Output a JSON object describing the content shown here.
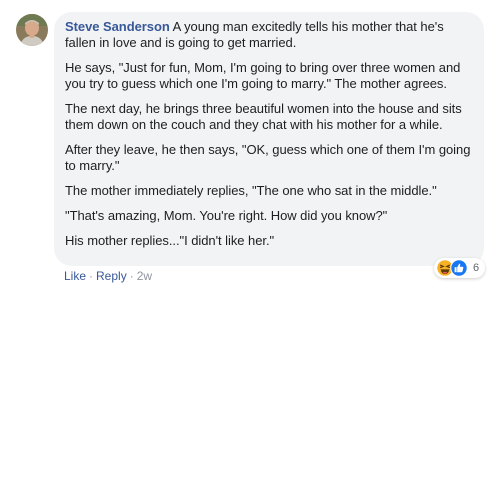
{
  "comment": {
    "author": "Steve Sanderson",
    "paragraphs": [
      "A young man excitedly tells his mother that he's fallen in love and is going to get married.",
      "He says, \"Just for fun, Mom, I'm going to bring over three women and you try to guess which one I'm going to marry.\" The mother agrees.",
      "The next day, he brings three beautiful women into the house and sits them down on the couch and they chat with his mother for a while.",
      "After they leave, he then says, \"OK, guess which one of them I'm going to marry.\"",
      "The mother immediately replies, \"The one who sat in the middle.\"",
      "\"That's amazing, Mom. You're right. How did you know?\"",
      "His mother replies...\"I didn't like her.\""
    ]
  },
  "actions": {
    "like_label": "Like",
    "reply_label": "Reply",
    "timestamp": "2w",
    "separator": "·"
  },
  "reactions": {
    "count": "6",
    "icons": [
      "haha-icon",
      "like-icon"
    ],
    "colors": {
      "haha": "#f7b125",
      "like": "#1877f2"
    }
  },
  "colors": {
    "author": "#385898",
    "bubble": "#f2f3f5",
    "text": "#1c1e21",
    "meta": "#90949c"
  }
}
